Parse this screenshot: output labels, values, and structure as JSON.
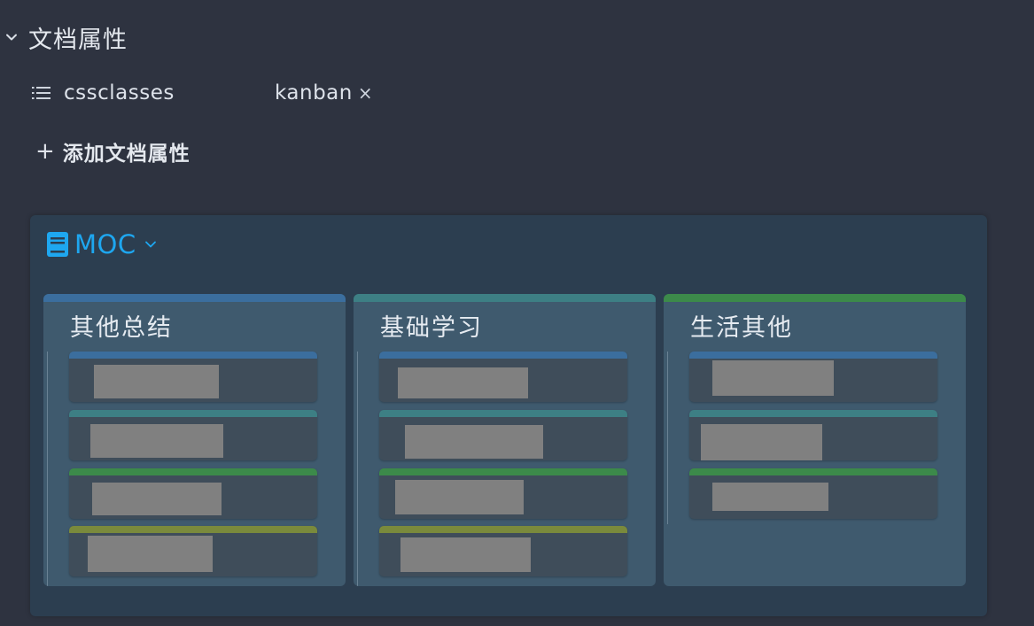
{
  "properties": {
    "title": "文档属性",
    "items": [
      {
        "key": "cssclasses",
        "value": "kanban",
        "remove_label": "×"
      }
    ],
    "add_label": "添加文档属性",
    "add_icon": "+"
  },
  "moc": {
    "title": "MOC",
    "icon": "book-icon",
    "colors": {
      "accent": "#1ea7f0",
      "blue": "#3b6e9e",
      "teal": "#3d7f84",
      "green": "#3c8a4a",
      "olive": "#7a8a3c"
    },
    "columns": [
      {
        "title": "其他总结",
        "bar": "blue",
        "cards": [
          "blue",
          "teal",
          "green",
          "olive"
        ]
      },
      {
        "title": "基础学习",
        "bar": "teal",
        "cards": [
          "blue",
          "teal",
          "green",
          "olive"
        ]
      },
      {
        "title": "生活其他",
        "bar": "green",
        "cards": [
          "blue",
          "teal",
          "green"
        ]
      }
    ]
  }
}
